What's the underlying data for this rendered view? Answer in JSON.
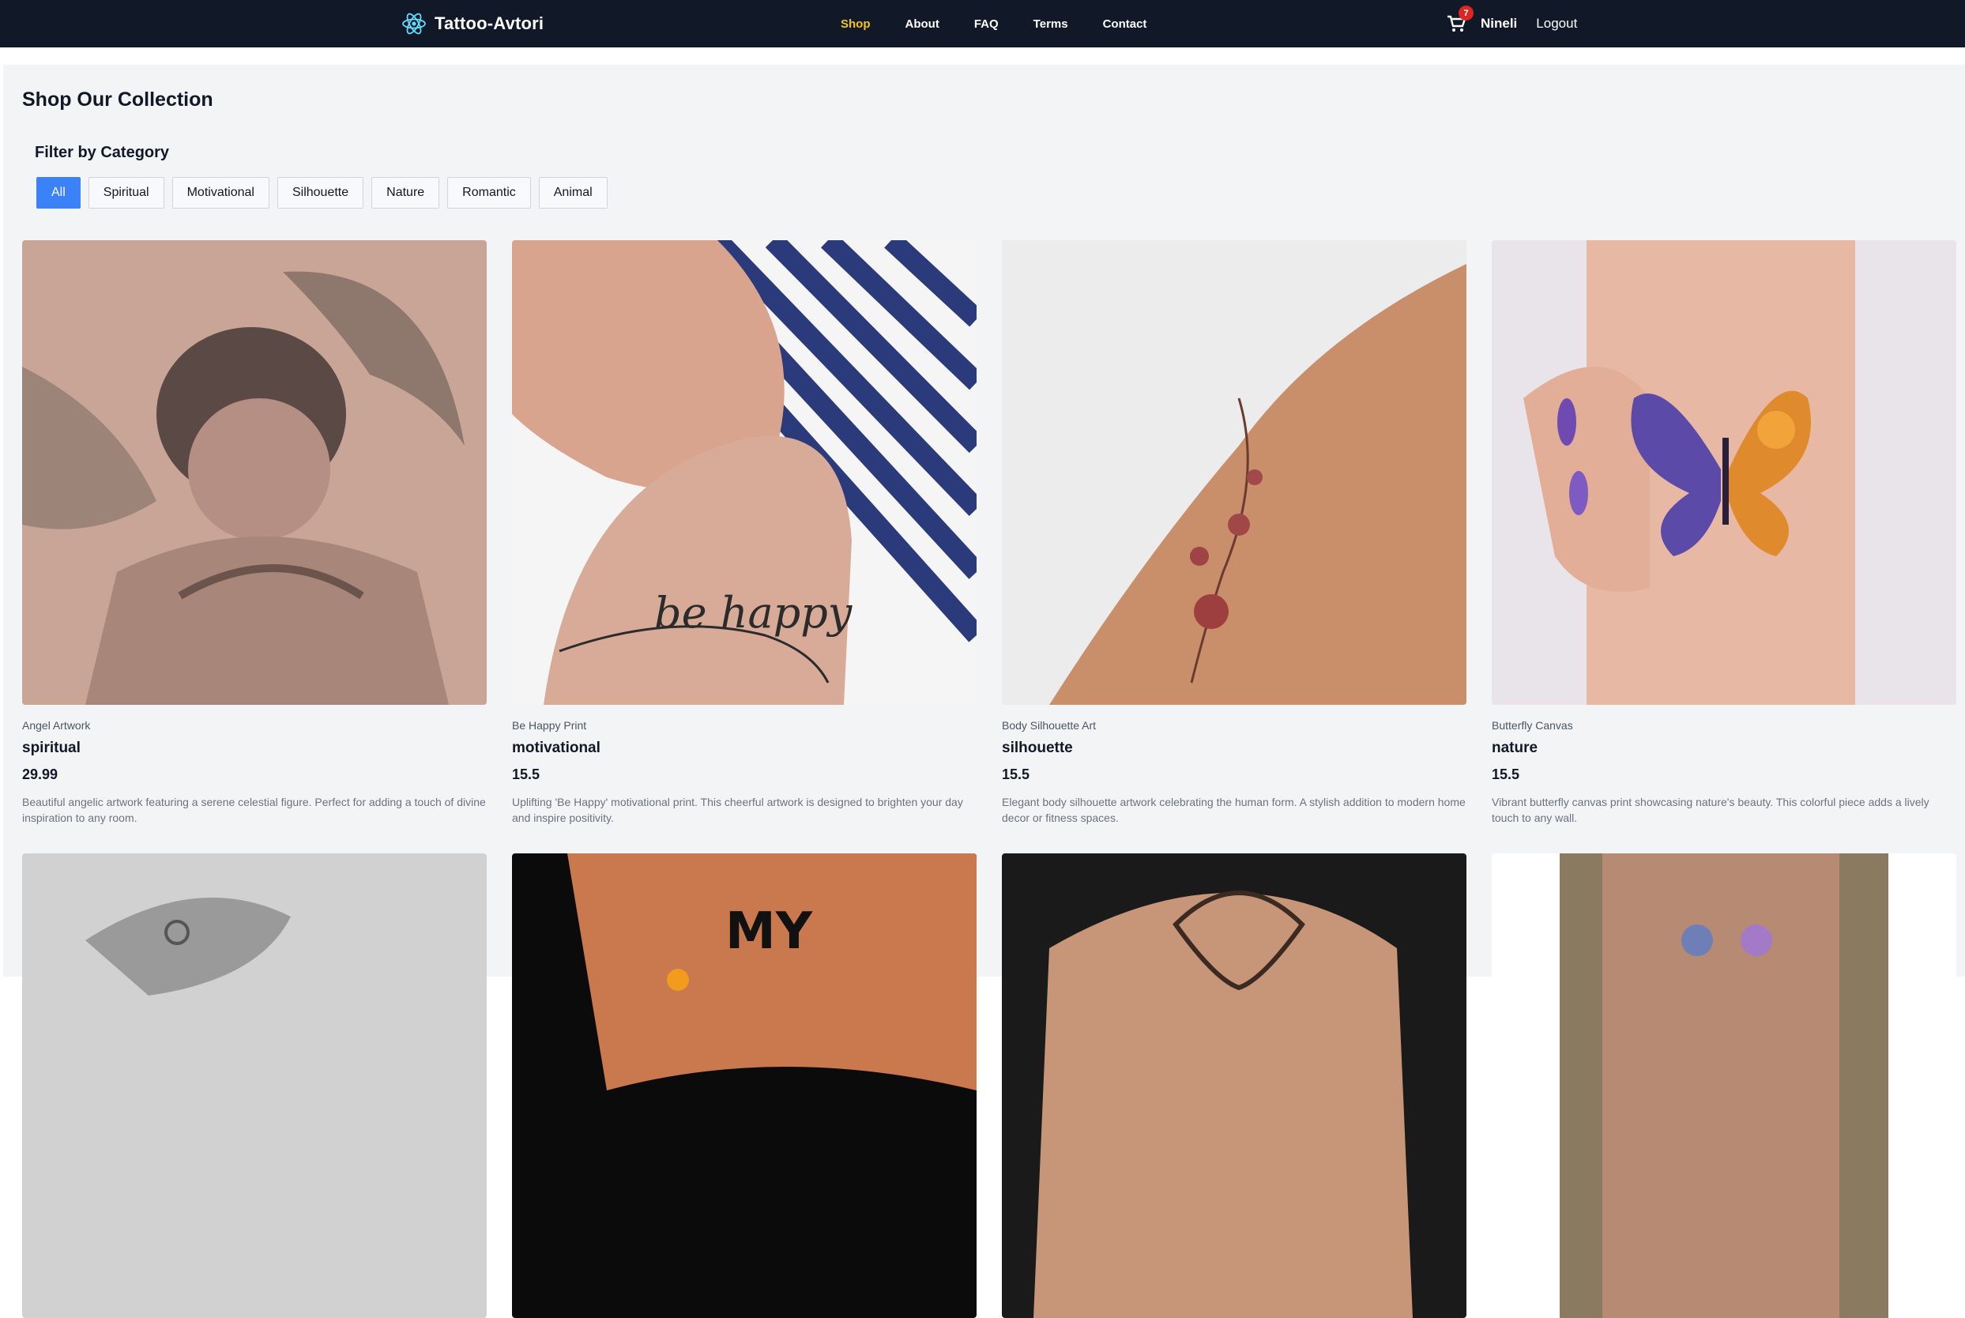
{
  "header": {
    "brand": "Tattoo-Avtori",
    "brand_icon": "react-atom-icon",
    "nav": [
      {
        "label": "Shop",
        "active": true
      },
      {
        "label": "About",
        "active": false
      },
      {
        "label": "FAQ",
        "active": false
      },
      {
        "label": "Terms",
        "active": false
      },
      {
        "label": "Contact",
        "active": false
      }
    ],
    "cart_icon": "cart-icon",
    "cart_count": "7",
    "user_name": "Nineli",
    "logout_label": "Logout"
  },
  "main": {
    "title": "Shop Our Collection",
    "filter_title": "Filter by Category",
    "filters": [
      {
        "label": "All",
        "active": true
      },
      {
        "label": "Spiritual",
        "active": false
      },
      {
        "label": "Motivational",
        "active": false
      },
      {
        "label": "Silhouette",
        "active": false
      },
      {
        "label": "Nature",
        "active": false
      },
      {
        "label": "Romantic",
        "active": false
      },
      {
        "label": "Animal",
        "active": false
      }
    ],
    "products": [
      {
        "name": "Angel Artwork",
        "category": "spiritual",
        "price": "29.99",
        "description": "Beautiful angelic artwork featuring a serene celestial figure. Perfect for adding a touch of divine inspiration to any room."
      },
      {
        "name": "Be Happy Print",
        "category": "motivational",
        "price": "15.5",
        "description": "Uplifting 'Be Happy' motivational print. This cheerful artwork is designed to brighten your day and inspire positivity.",
        "image_text": "be happy"
      },
      {
        "name": "Body Silhouette Art",
        "category": "silhouette",
        "price": "15.5",
        "description": "Elegant body silhouette artwork celebrating the human form. A stylish addition to modern home decor or fitness spaces."
      },
      {
        "name": "Butterfly Canvas",
        "category": "nature",
        "price": "15.5",
        "description": "Vibrant butterfly canvas print showcasing nature's beauty. This colorful piece adds a lively touch to any wall."
      }
    ],
    "second_row_image_text": "MY"
  }
}
